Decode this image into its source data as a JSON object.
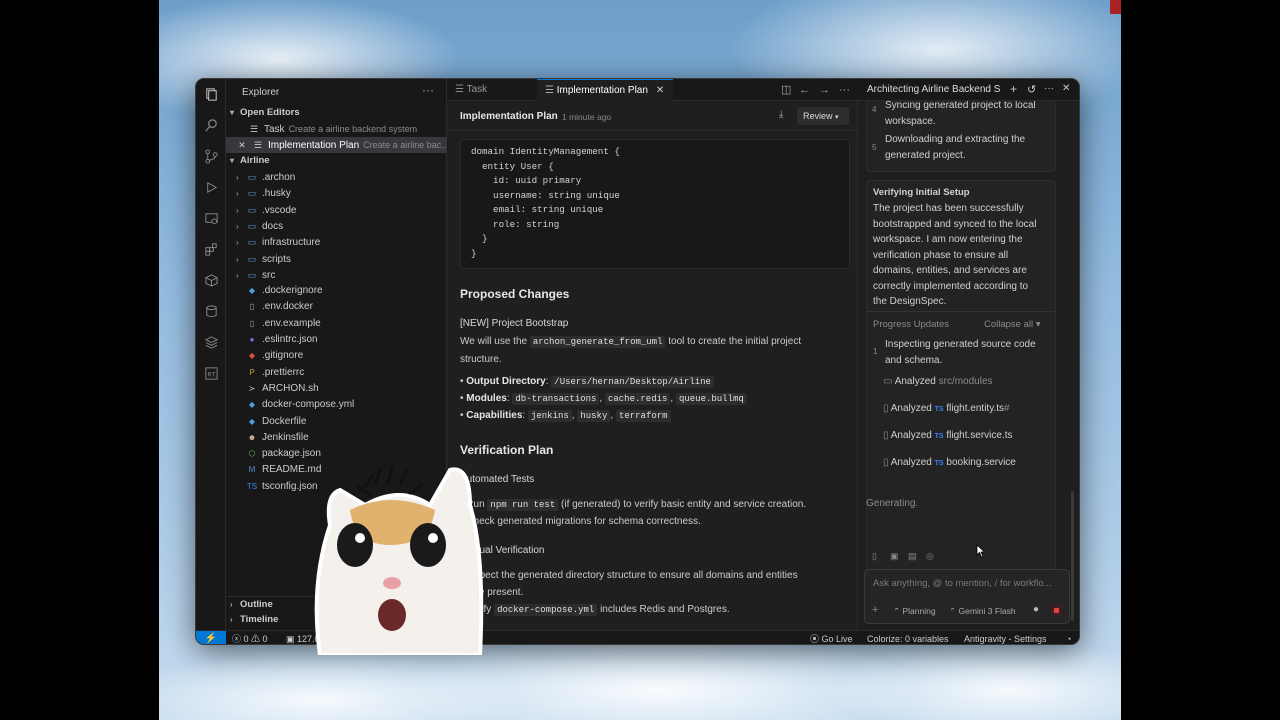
{
  "explorer": {
    "title": "Explorer",
    "open_editors_label": "Open Editors",
    "open_editors": [
      {
        "name": "Task",
        "desc": "Create a airline backend system"
      },
      {
        "name": "Implementation Plan",
        "desc": "Create a airline bac..."
      }
    ],
    "project_label": "Airline",
    "folders": [
      ".archon",
      ".husky",
      ".vscode",
      "docs",
      "infrastructure",
      "scripts",
      "src"
    ],
    "files": [
      ".dockerignore",
      ".env.docker",
      ".env.example",
      ".eslintrc.json",
      ".gitignore",
      ".prettierrc",
      "ARCHON.sh",
      "docker-compose.yml",
      "Dockerfile",
      "Jenkinsfile",
      "package.json",
      "README.md",
      "tsconfig.json"
    ],
    "outline_label": "Outline",
    "timeline_label": "Timeline"
  },
  "tabs": [
    {
      "label": "Task"
    },
    {
      "label": "Implementation Plan"
    }
  ],
  "editor": {
    "doc_title": "Implementation Plan",
    "doc_time": "1 minute ago",
    "review_label": "Review",
    "code_lines": [
      "domain IdentityManagement {",
      "  entity User {",
      "    id: uuid primary",
      "    username: string unique",
      "    email: string unique",
      "    role: string",
      "  }",
      "}"
    ],
    "proposed_heading": "Proposed Changes",
    "bootstrap_heading": "[NEW] Project Bootstrap",
    "bootstrap_p1": "We will use the",
    "bootstrap_code": "archon_generate_from_uml",
    "bootstrap_p2": "tool to create the initial project",
    "bootstrap_p3": "structure.",
    "output_label": "Output Directory",
    "output_value": "/Users/hernan/Desktop/Airline",
    "modules_label": "Modules",
    "modules_values": [
      "db-transactions",
      "cache.redis",
      "queue.bullmq"
    ],
    "capabilities_label": "Capabilities",
    "capabilities_values": [
      "jenkins",
      "husky",
      "terraform"
    ],
    "verification_heading": "Verification Plan",
    "automated_heading": "Automated Tests",
    "auto_1a": "Run",
    "auto_1_code": "npm run test",
    "auto_1b": "(if generated) to verify basic entity and service creation.",
    "auto_2": "Check generated migrations for schema correctness.",
    "manual_heading": "Manual Verification",
    "manual_1a": "Inspect the generated directory structure to ensure all domains and entities",
    "manual_1b": "are present.",
    "manual_2a": "Verify",
    "manual_2_code": "docker-compose.yml",
    "manual_2b": "includes Redis and Postgres."
  },
  "chat": {
    "title": "Architecting Airline Backend S",
    "step4_num": "4",
    "step4_text": "Syncing generated project to local workspace.",
    "step5_num": "5",
    "step5_text_a": "Downloading and extracting the",
    "step5_text_b": "generated project.",
    "verify_heading": "Verifying Initial Setup",
    "verify_lines": [
      "The project has been successfully",
      "bootstrapped and synced to the local",
      "workspace. I am now entering the",
      "verification phase to ensure all",
      "domains, entities, and services are",
      "correctly implemented according to",
      "the DesignSpec."
    ],
    "progress_label": "Progress Updates",
    "collapse_label": "Collapse all",
    "step1_num": "1",
    "step1_a": "Inspecting generated source code",
    "step1_b": "and schema.",
    "analyzed_label": "Analyzed",
    "analyzed": [
      "src/modules",
      "flight.entity.ts",
      "flight.service.ts",
      "booking.service"
    ],
    "ts_tag": "TS",
    "flight_entity_suffix": "#",
    "generating": "Generating.",
    "input_placeholder": "Ask anything, @ to mention, / for workflo...",
    "mode_label": "Planning",
    "model_label": "Gemini 3 Flash"
  },
  "status": {
    "errors": "0",
    "warnings": "0",
    "host": "127.0.0.",
    "go_live": "Go Live",
    "colorize": "Colorize: 0 variables",
    "settings": "Antigravity - Settings"
  }
}
